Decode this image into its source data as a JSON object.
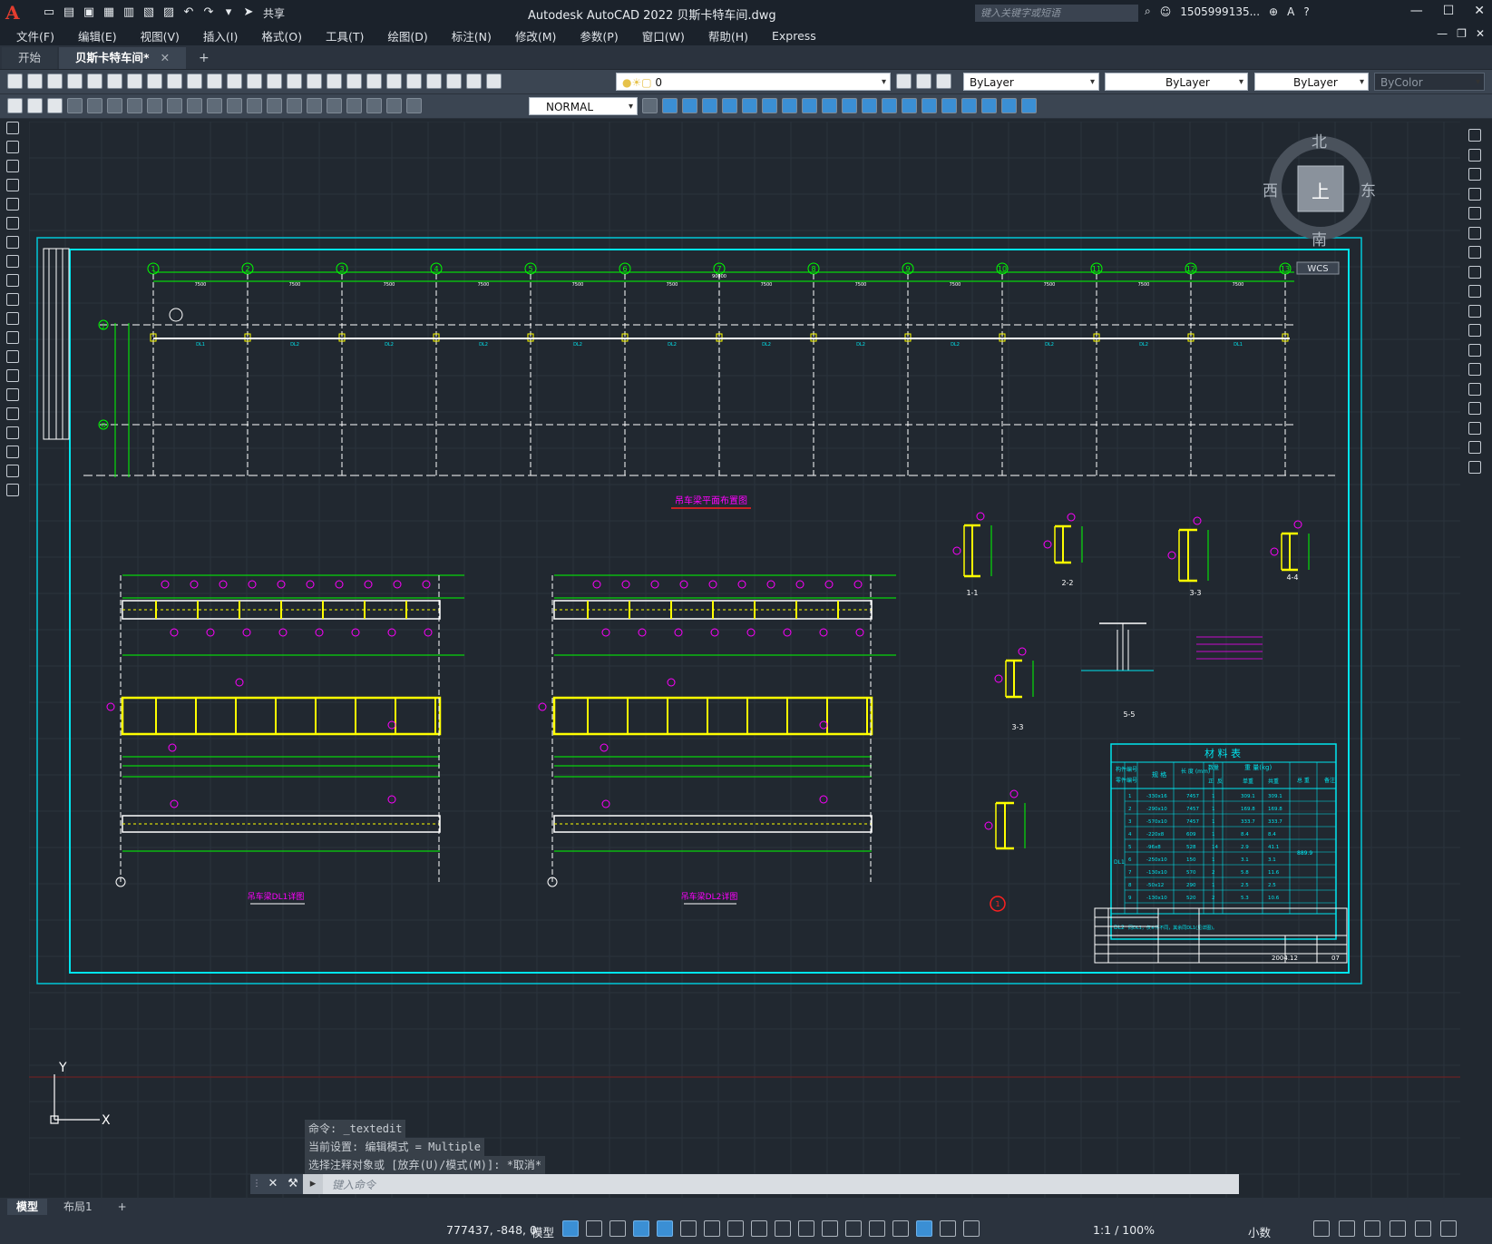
{
  "titlebar": {
    "logo": "A",
    "share_label": "共享",
    "window_title": "Autodesk AutoCAD 2022    贝斯卡特车间.dwg",
    "search_placeholder": "键入关键字或短语",
    "user": "1505999135...",
    "controls": [
      "—",
      "☐",
      "✕"
    ]
  },
  "menubar": {
    "items": [
      "文件(F)",
      "编辑(E)",
      "视图(V)",
      "插入(I)",
      "格式(O)",
      "工具(T)",
      "绘图(D)",
      "标注(N)",
      "修改(M)",
      "参数(P)",
      "窗口(W)",
      "帮助(H)",
      "Express"
    ]
  },
  "tabs": {
    "start": "开始",
    "active": "贝斯卡特车间*",
    "close": "✕",
    "add": "+"
  },
  "toolbar": {
    "layer_value": "0",
    "color_value": "ByLayer",
    "linetype_value": "ByLayer",
    "lineweight_value": "ByLayer",
    "plotstyle_value": "ByColor",
    "text_style_value": "NORMAL"
  },
  "viewcube": {
    "north": "北",
    "south": "南",
    "east": "东",
    "west": "西",
    "top": "上",
    "wcs": "WCS"
  },
  "drawing": {
    "plan_title": "吊车梁平面布置图",
    "dl1_title": "吊车梁DL1详图",
    "dl2_title": "吊车梁DL2详图",
    "grid_numbers": [
      "1",
      "2",
      "3",
      "4",
      "5",
      "6",
      "7",
      "8",
      "9",
      "10",
      "11",
      "12",
      "13"
    ],
    "bay_dims": [
      "7500",
      "7500",
      "7500",
      "7500",
      "7500",
      "7500",
      "7500",
      "7500",
      "7500",
      "7500",
      "7500",
      "7500"
    ],
    "total_dim": "90000",
    "row_labels": [
      "J",
      "G"
    ],
    "beam_labels": [
      "DL1",
      "DL2",
      "DL2",
      "DL2",
      "DL2",
      "DL2",
      "DL2",
      "DL2",
      "DL2",
      "DL2",
      "DL2",
      "DL1"
    ],
    "section_labels": [
      "1-1",
      "2-2",
      "3-3",
      "4-4",
      "5-5",
      "3-3"
    ],
    "material_table": {
      "title": "材  料  表",
      "headers": [
        "构件编号",
        "零件编号",
        "规 格",
        "长 度 (mm)",
        "数量",
        "重 量(kg)",
        "总 重",
        "备注"
      ],
      "sub_headers": [
        "正",
        "反",
        "单重",
        "共重"
      ],
      "rows": [
        [
          "1",
          "-330x16",
          "7457",
          "1",
          "309.1",
          "309.1"
        ],
        [
          "2",
          "-290x10",
          "7457",
          "1",
          "169.8",
          "169.8"
        ],
        [
          "3",
          "-570x10",
          "7457",
          "1",
          "333.7",
          "333.7"
        ],
        [
          "4",
          "-220x8",
          "609",
          "1",
          "8.4",
          "8.4"
        ],
        [
          "5",
          "-96x8",
          "528",
          "14",
          "2.9",
          "41.1"
        ],
        [
          "6",
          "-250x10",
          "150",
          "1",
          "3.1",
          "3.1"
        ],
        [
          "7",
          "-130x10",
          "570",
          "2",
          "5.8",
          "11.6"
        ],
        [
          "8",
          "-50x12",
          "290",
          "1",
          "2.5",
          "2.5"
        ],
        [
          "9",
          "-130x10",
          "520",
          "2",
          "5.3",
          "10.6"
        ]
      ],
      "group_id": "DL1",
      "total": "889.9",
      "footer_id": "DL2",
      "footer_note": "同DL1，仅⑥件不同，其余同DL1(见详图)。"
    },
    "title_block_date": "2004.12",
    "title_block_sheet": "07",
    "detail_marker": "1"
  },
  "command": {
    "history": [
      "命令: _textedit",
      "当前设置: 编辑模式 = Multiple",
      "选择注释对象或 [放弃(U)/模式(M)]: *取消*"
    ],
    "placeholder": "键入命令"
  },
  "layouts": {
    "model": "模型",
    "layout1": "布局1",
    "add": "+"
  },
  "status": {
    "coords": "777437, -848, 0",
    "model": "模型",
    "scale": "1:1 / 100%",
    "units": "小数"
  },
  "ucs": {
    "x": "X",
    "y": "Y"
  },
  "colors": {
    "cyan": "#00e5ee",
    "green": "#00ff00",
    "yellow": "#ffff00",
    "magenta": "#ff00ff",
    "white": "#ffffff",
    "red": "#ff2020"
  }
}
